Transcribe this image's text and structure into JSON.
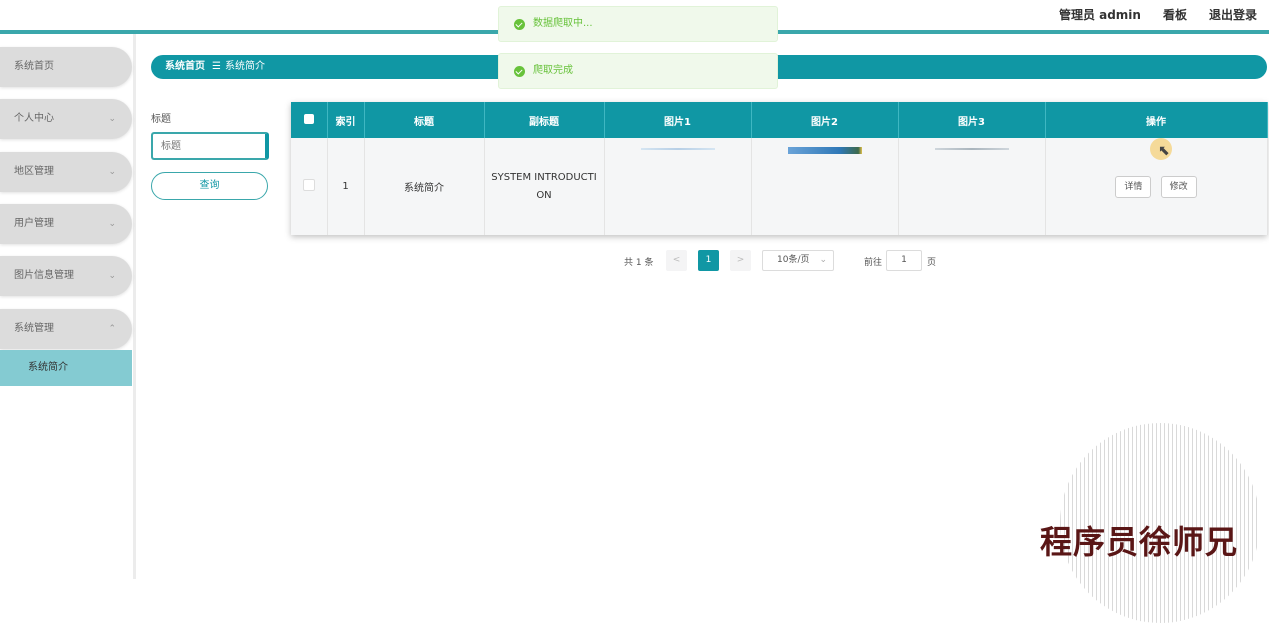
{
  "header": {
    "user_label": "管理员 admin",
    "board": "看板",
    "logout": "退出登录"
  },
  "sidebar": {
    "items": [
      {
        "label": "系统首页",
        "chevron": ""
      },
      {
        "label": "个人中心",
        "chevron": "⌄"
      },
      {
        "label": "地区管理",
        "chevron": "⌄"
      },
      {
        "label": "用户管理",
        "chevron": "⌄"
      },
      {
        "label": "图片信息管理",
        "chevron": "⌄"
      },
      {
        "label": "系统管理",
        "chevron": "⌃"
      }
    ],
    "sub_item": "系统简介"
  },
  "breadcrumb": {
    "home": "系统首页",
    "separator": "☰",
    "current": "系统简介"
  },
  "search": {
    "label": "标题",
    "placeholder": "标题",
    "button": "查询"
  },
  "table": {
    "headers": [
      "索引",
      "标题",
      "副标题",
      "图片1",
      "图片2",
      "图片3",
      "操作"
    ],
    "rows": [
      {
        "index": "1",
        "title": "系统简介",
        "subtitle": "SYSTEM INTRODUCTION",
        "detail": "详情",
        "edit": "修改"
      }
    ]
  },
  "pagination": {
    "total": "共 1 条",
    "prev": "<",
    "current": "1",
    "next": ">",
    "page_size": "10条/页",
    "goto_prefix": "前往",
    "goto_value": "1",
    "goto_suffix": "页"
  },
  "toasts": [
    "数据爬取中...",
    "爬取完成"
  ],
  "watermark": "程序员徐师兄",
  "colors": {
    "accent": "#1097a4",
    "success": "#67c23a",
    "sidebar_item": "#dcdcdc",
    "sub_item": "#84cbd2"
  }
}
